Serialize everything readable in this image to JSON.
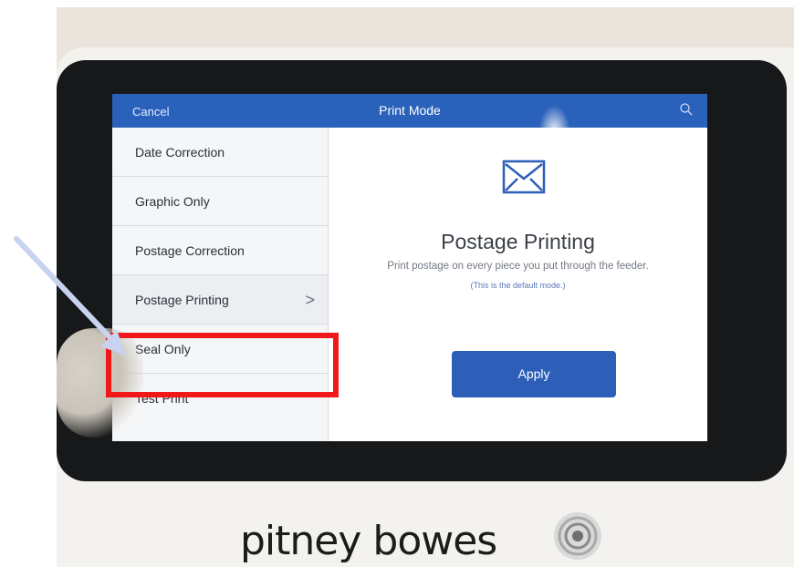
{
  "header": {
    "cancel_label": "Cancel",
    "title": "Print Mode",
    "search_icon": "search-icon"
  },
  "sidebar": {
    "items": [
      {
        "label": "Date Correction"
      },
      {
        "label": "Graphic Only"
      },
      {
        "label": "Postage Correction"
      },
      {
        "label": "Postage Printing",
        "selected": true,
        "chevron": ">"
      },
      {
        "label": "Seal Only"
      },
      {
        "label": "Test Print"
      }
    ]
  },
  "content": {
    "icon": "envelope-icon",
    "title": "Postage Printing",
    "description": "Print postage on every piece you put through the feeder.",
    "note": "(This is the default mode.)",
    "apply_label": "Apply"
  },
  "branding": {
    "logo_text": "pitney bowes"
  },
  "colors": {
    "header": "#2a61ba",
    "apply": "#2d5fb9",
    "highlight": "#f01818",
    "arrow": "#c8d3f0"
  }
}
